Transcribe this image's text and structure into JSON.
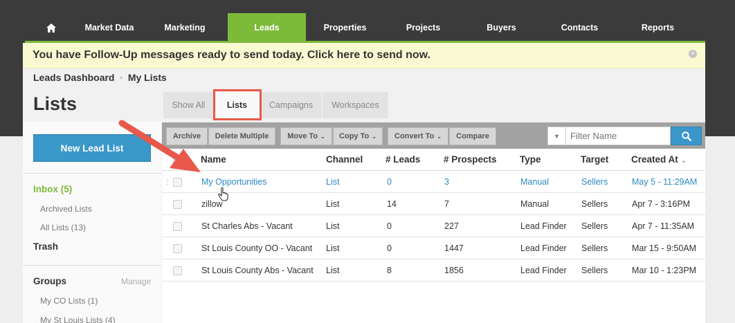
{
  "nav": {
    "items": [
      {
        "label": "",
        "icon": "home-icon"
      },
      {
        "label": "Market Data"
      },
      {
        "label": "Marketing"
      },
      {
        "label": "Leads",
        "active": true
      },
      {
        "label": "Properties"
      },
      {
        "label": "Projects"
      },
      {
        "label": "Buyers"
      },
      {
        "label": "Contacts"
      },
      {
        "label": "Reports"
      }
    ]
  },
  "alert": {
    "text": "You have Follow-Up messages ready to send today. Click here to send now.",
    "close": "×"
  },
  "breadcrumb": {
    "items": [
      "Leads Dashboard",
      "My Lists"
    ],
    "separator": "›"
  },
  "page": {
    "title": "Lists"
  },
  "tabs": [
    {
      "label": "Show All"
    },
    {
      "label": "Lists",
      "active": true
    },
    {
      "label": "Campaigns"
    },
    {
      "label": "Workspaces"
    }
  ],
  "sidebar": {
    "new_button": "New Lead List",
    "inbox": "Inbox (5)",
    "archived": "Archived Lists",
    "all": "All Lists (13)",
    "trash": "Trash",
    "groups_title": "Groups",
    "groups_manage": "Manage",
    "groups": [
      "My CO Lists (1)",
      "My St Louis Lists (4)"
    ]
  },
  "toolbar": {
    "archive": "Archive",
    "delete_multiple": "Delete Multiple",
    "move_to": "Move To",
    "copy_to": "Copy To",
    "convert_to": "Convert To",
    "compare": "Compare",
    "filter_placeholder": "Filter Name"
  },
  "table": {
    "headers": [
      "Name",
      "Channel",
      "# Leads",
      "# Prospects",
      "Type",
      "Target",
      "Created At"
    ],
    "rows": [
      {
        "name": "My Opportunities",
        "channel": "List",
        "leads": "0",
        "prospects": "3",
        "type": "Manual",
        "target": "Sellers",
        "created": "May 5 - 11:29AM"
      },
      {
        "name": "zillow",
        "channel": "List",
        "leads": "14",
        "prospects": "7",
        "type": "Manual",
        "target": "Sellers",
        "created": "Apr 7 - 3:16PM"
      },
      {
        "name": "St Charles Abs - Vacant",
        "channel": "List",
        "leads": "0",
        "prospects": "227",
        "type": "Lead Finder",
        "target": "Sellers",
        "created": "Apr 7 - 11:35AM"
      },
      {
        "name": "St Louis County OO - Vacant",
        "channel": "List",
        "leads": "0",
        "prospects": "1447",
        "type": "Lead Finder",
        "target": "Sellers",
        "created": "Mar 15 - 9:50AM"
      },
      {
        "name": "St Louis County Abs - Vacant",
        "channel": "List",
        "leads": "8",
        "prospects": "1856",
        "type": "Lead Finder",
        "target": "Sellers",
        "created": "Mar 10 - 1:23PM"
      }
    ]
  },
  "colors": {
    "accent": "#7cba3a",
    "primary": "#3a97c9",
    "highlight": "#e8584b",
    "link": "#2b8ac2"
  }
}
